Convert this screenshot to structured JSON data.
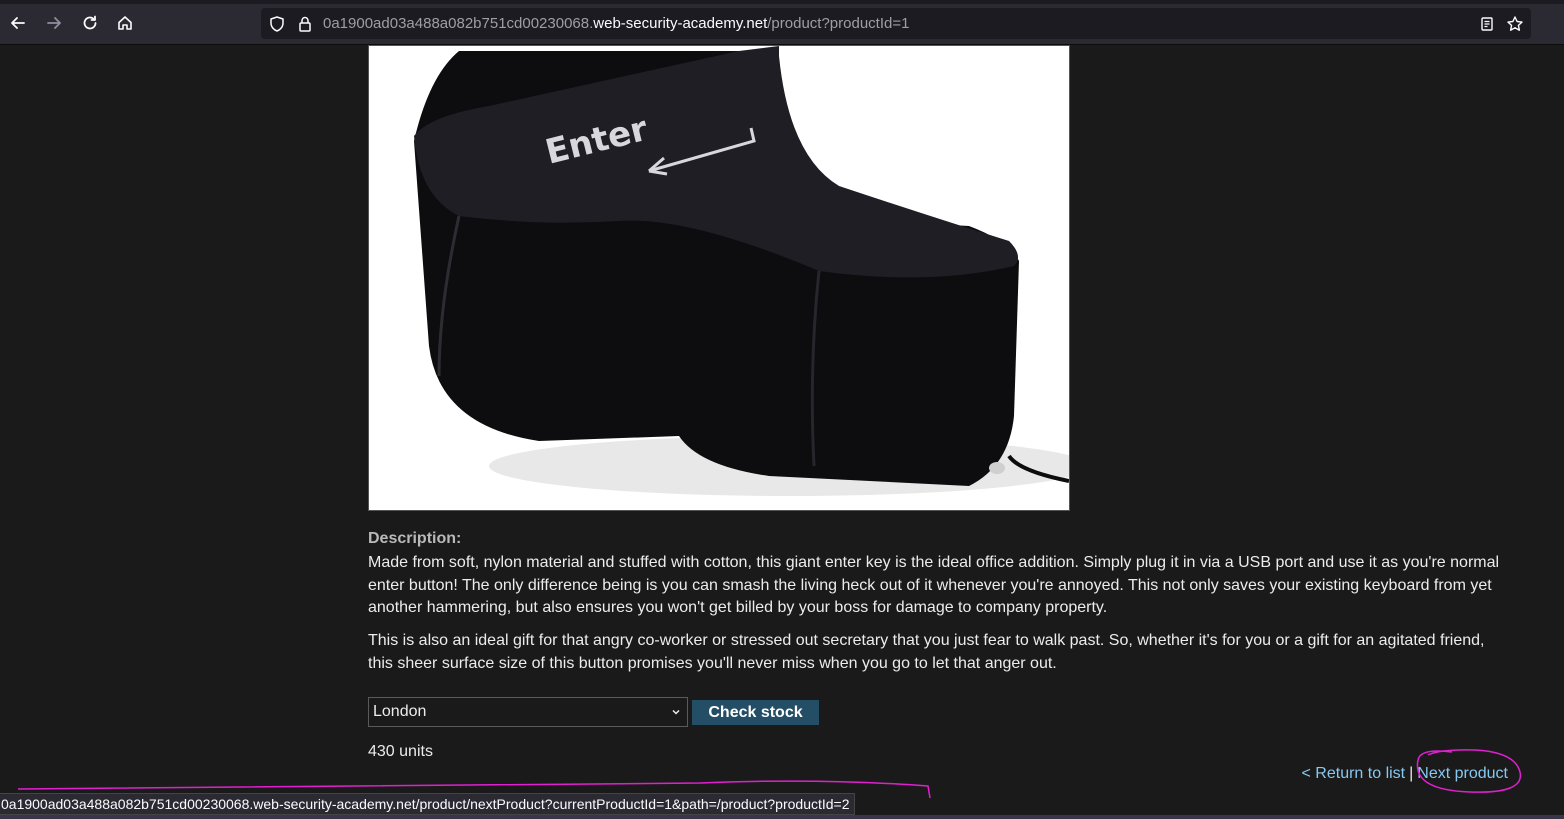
{
  "browser": {
    "url_prefix": "0a1900ad03a488a082b751cd00230068.",
    "url_host": "web-security-academy.net",
    "url_path": "/product?productId=1",
    "icons": [
      "back-arrow-icon",
      "forward-arrow-icon",
      "reload-icon",
      "home-icon",
      "shield-icon",
      "lock-icon",
      "reader-view-icon",
      "bookmark-star-icon"
    ]
  },
  "product": {
    "image_alt": "Giant Enter key",
    "image_key_text": "Enter",
    "description_heading": "Description:",
    "description_paragraphs": [
      "Made from soft, nylon material and stuffed with cotton, this giant enter key is the ideal office addition. Simply plug it in via a USB port and use it as you're normal enter button! The only difference being is you can smash the living heck out of it whenever you're annoyed. This not only saves your existing keyboard from yet another hammering, but also ensures you won't get billed by your boss for damage to company property.",
      "This is also an ideal gift for that angry co-worker or stressed out secretary that you just fear to walk past. So, whether it's for you or a gift for an agitated friend, this sheer surface size of this button promises you'll never miss when you go to let that anger out."
    ]
  },
  "stock": {
    "selected_store": "London",
    "check_button_label": "Check stock",
    "result": "430 units"
  },
  "footer": {
    "return_link": "< Return to list",
    "separator": "|",
    "next_link": "Next product"
  },
  "status_bar": {
    "link_url": "0a1900ad03a488a082b751cd00230068.web-security-academy.net/product/nextProduct?currentProductId=1&path=/product?productId=2"
  },
  "colors": {
    "page_bg": "#1a1a1a",
    "link": "#87c8f0",
    "button_bg": "#244d66",
    "annotation": "#e020d0"
  }
}
